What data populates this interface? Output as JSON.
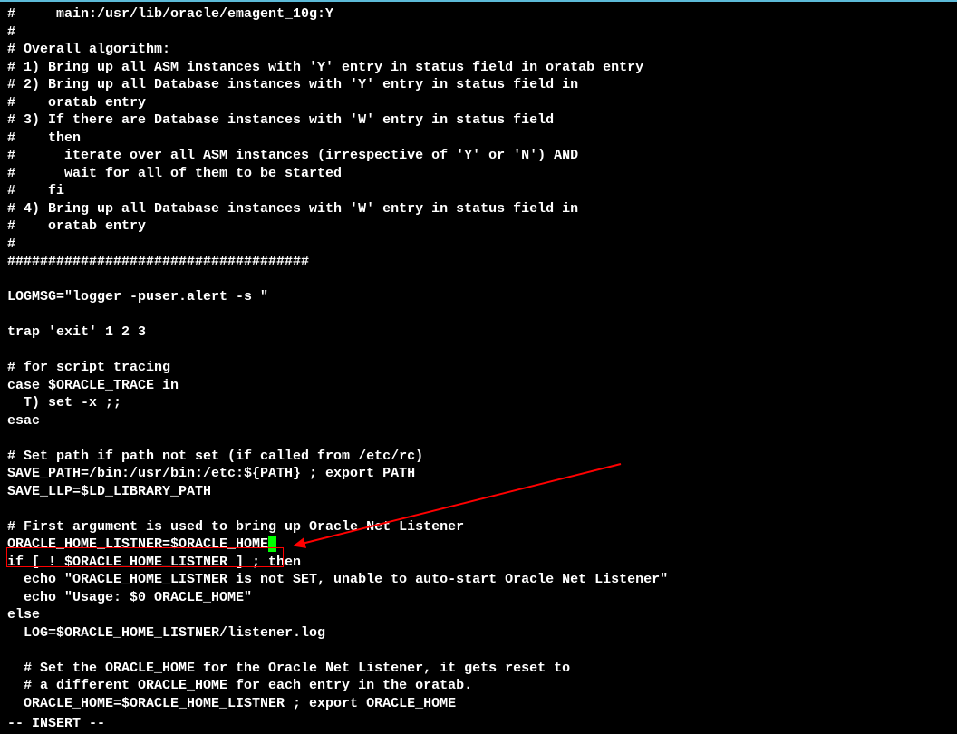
{
  "terminal": {
    "lines": [
      "#     main:/usr/lib/oracle/emagent_10g:Y",
      "#",
      "# Overall algorithm:",
      "# 1) Bring up all ASM instances with 'Y' entry in status field in oratab entry",
      "# 2) Bring up all Database instances with 'Y' entry in status field in",
      "#    oratab entry",
      "# 3) If there are Database instances with 'W' entry in status field",
      "#    then",
      "#      iterate over all ASM instances (irrespective of 'Y' or 'N') AND",
      "#      wait for all of them to be started",
      "#    fi",
      "# 4) Bring up all Database instances with 'W' entry in status field in",
      "#    oratab entry",
      "#",
      "#####################################",
      "",
      "LOGMSG=\"logger -puser.alert -s \"",
      "",
      "trap 'exit' 1 2 3",
      "",
      "# for script tracing",
      "case $ORACLE_TRACE in",
      "  T) set -x ;;",
      "esac",
      "",
      "# Set path if path not set (if called from /etc/rc)",
      "SAVE_PATH=/bin:/usr/bin:/etc:${PATH} ; export PATH",
      "SAVE_LLP=$LD_LIBRARY_PATH",
      "",
      "# First argument is used to bring up Oracle Net Listener",
      "ORACLE_HOME_LISTNER=$ORACLE_HOME",
      "if [ ! $ORACLE_HOME_LISTNER ] ; then",
      "  echo \"ORACLE_HOME_LISTNER is not SET, unable to auto-start Oracle Net Listener\"",
      "  echo \"Usage: $0 ORACLE_HOME\"",
      "else",
      "  LOG=$ORACLE_HOME_LISTNER/listener.log",
      "",
      "  # Set the ORACLE_HOME for the Oracle Net Listener, it gets reset to",
      "  # a different ORACLE_HOME for each entry in the oratab.",
      "  ORACLE_HOME=$ORACLE_HOME_LISTNER ; export ORACLE_HOME"
    ],
    "cursor_line": 30,
    "status": "-- INSERT --"
  }
}
